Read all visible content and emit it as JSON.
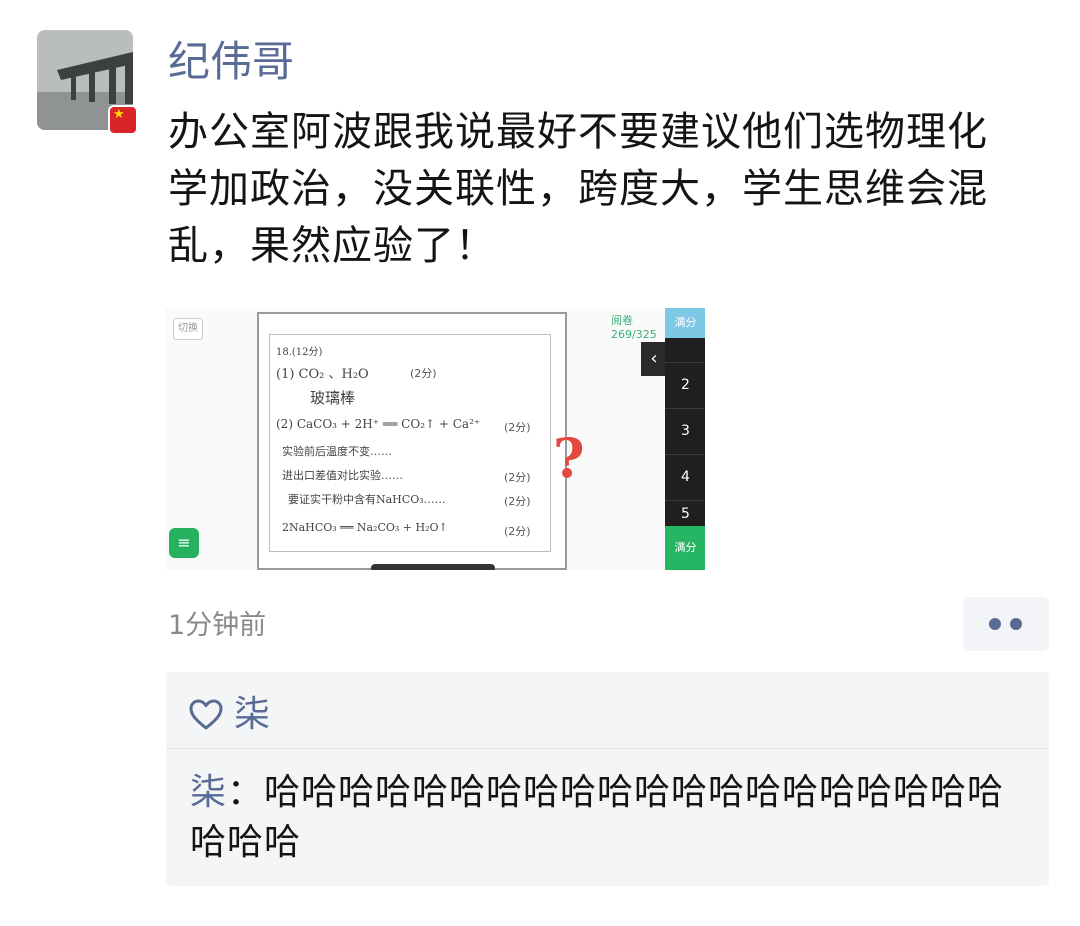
{
  "post": {
    "author": "纪伟哥",
    "text": "办公室阿波跟我说最好不要建议他们选物理化学加政治，没关联性，跨度大，学生思维会混乱，果然应验了！",
    "timestamp": "1分钟前",
    "more_icon": "ellipsis-dots-icon",
    "flag_icon": "china-flag-icon"
  },
  "image": {
    "side_tag": "切换",
    "lines": {
      "header": "18.(12分)",
      "l1": "(1)  CO₂ 、H₂O",
      "l2": "玻璃棒",
      "l3": "(2)  CaCO₃ + 2H⁺ ══ CO₂↑ + Ca²⁺",
      "l4": "实验前后温度不变……",
      "l5": "进出口差值对比实验……",
      "l6": "要证实干粉中含有NaHCO₃……",
      "l7": "2NaHCO₃ ══ Na₂CO₃ + H₂O↑"
    },
    "score": "(2分)",
    "panel_label": "阅卷\n269/325",
    "col_top": "满分",
    "numbers": [
      "2",
      "3",
      "4",
      "5"
    ],
    "col_bottom": "满分",
    "question_mark": "?"
  },
  "interaction": {
    "like_icon": "heart-outline-icon",
    "likes_name": "柒",
    "comment_author": "柒",
    "comment_separator": "：",
    "comment_text": "哈哈哈哈哈哈哈哈哈哈哈哈哈哈哈哈哈哈哈哈哈哈哈"
  },
  "colors": {
    "name_blue": "#586b95",
    "text": "#141414",
    "timestamp_gray": "#8a8a8a",
    "panel_bg": "#f4f5f7",
    "flag_red": "#d9252a",
    "question_red": "#e24a3f",
    "green": "#26b562"
  }
}
